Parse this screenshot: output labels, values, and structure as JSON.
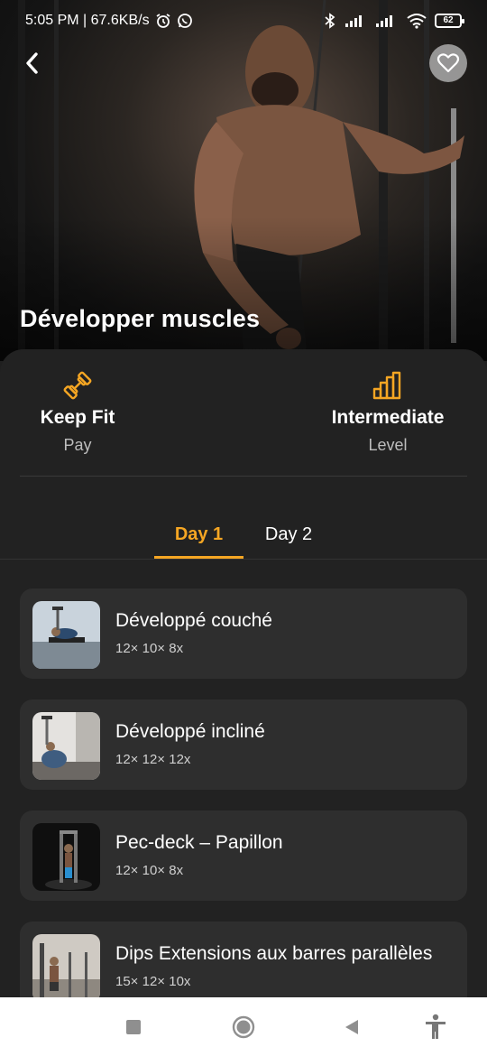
{
  "status_bar": {
    "time_info": "5:05 PM | 67.6KB/s",
    "battery": "62"
  },
  "hero": {
    "title": "Développer muscles"
  },
  "stats": {
    "left": {
      "value": "Keep Fit",
      "label": "Pay",
      "icon": "dumbbell-icon"
    },
    "right": {
      "value": "Intermediate",
      "label": "Level",
      "icon": "level-bars-icon"
    }
  },
  "tabs": [
    {
      "label": "Day 1",
      "active": true
    },
    {
      "label": "Day 2",
      "active": false
    }
  ],
  "exercises": [
    {
      "title": "Développé couché",
      "reps": "12× 10× 8x"
    },
    {
      "title": "Développé incliné",
      "reps": "12× 12× 12x"
    },
    {
      "title": "Pec-deck – Papillon",
      "reps": "12× 10× 8x"
    },
    {
      "title": "Dips Extensions aux barres parallèles",
      "reps": "15× 12× 10x"
    }
  ],
  "colors": {
    "accent": "#f5a623",
    "background": "#1f1f1f",
    "card": "#2e2e2e"
  },
  "nav_bar": [
    "recents-square-icon",
    "home-circle-icon",
    "back-triangle-icon",
    "accessibility-icon"
  ]
}
